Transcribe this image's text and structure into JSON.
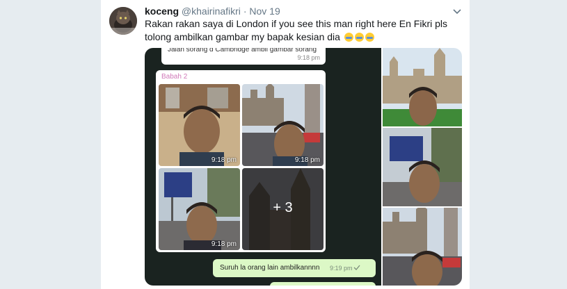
{
  "tweet": {
    "display_name": "koceng",
    "handle": "@khairinafikri",
    "separator": "·",
    "date": "Nov 19",
    "text": "Rakan rakan saya di London if you see this man right here En Fikri pls tolong ambilkan gambar my bapak kesian dia",
    "emoji": [
      "loudly-crying-face",
      "loudly-crying-face",
      "loudly-crying-face"
    ]
  },
  "chat": {
    "top_message": "Jalan sorang d Cambridge ambil gambar sorang",
    "top_time": "9:18 pm",
    "sender": "Babah 2",
    "photos": [
      {
        "time": "9:18 pm"
      },
      {
        "time": "9:18 pm"
      },
      {
        "time": "9:18 pm"
      },
      {
        "more_label": "+ 3"
      }
    ],
    "outgoing_message": "Suruh la orang lain ambilkannnn",
    "outgoing_time": "9:19 pm"
  },
  "colors": {
    "chat_bg": "#1a2320",
    "incoming_bubble": "#ffffff",
    "outgoing_bubble": "#dcf8c6",
    "sender_name": "#d079b8",
    "page_bg": "#e6ecf0"
  }
}
